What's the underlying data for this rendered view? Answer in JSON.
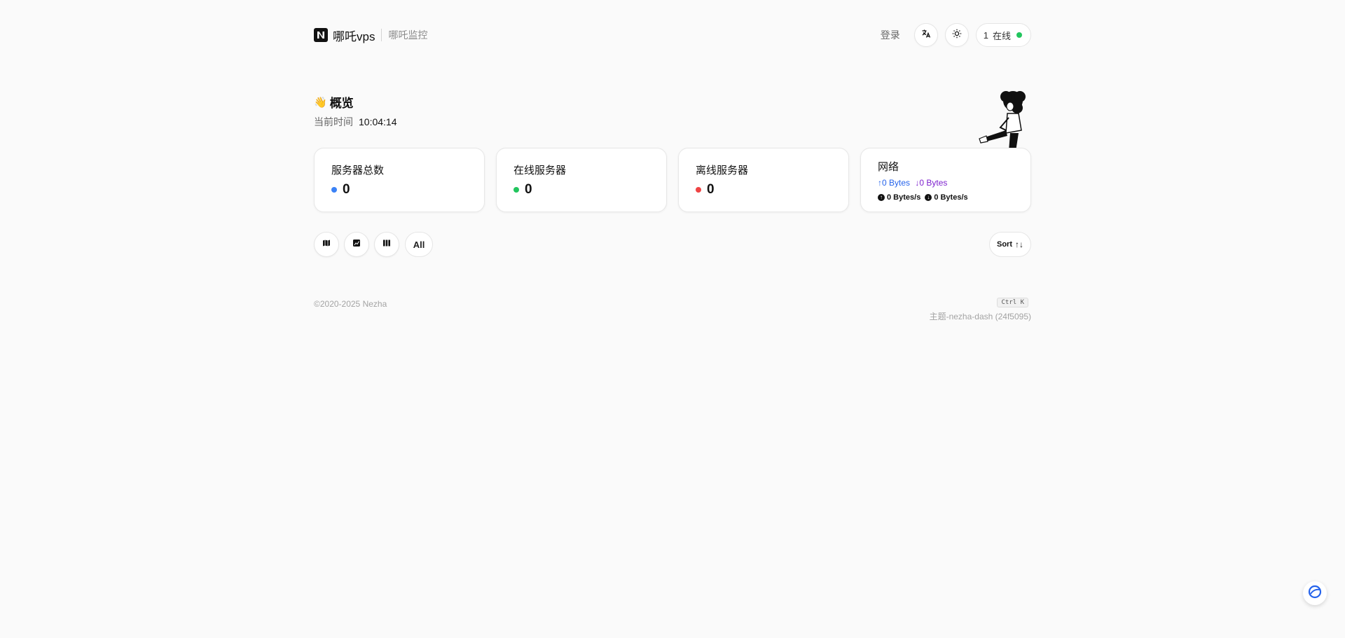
{
  "header": {
    "brand_name": "哪吒vps",
    "brand_sub": "哪吒监控",
    "login_label": "登录",
    "online_count": "1",
    "online_label": "在线"
  },
  "overview": {
    "title": "概览",
    "time_label": "当前时间",
    "time_value": "10:04:14"
  },
  "cards": {
    "total": {
      "title": "服务器总数",
      "value": "0",
      "color": "#3b82f6"
    },
    "online": {
      "title": "在线服务器",
      "value": "0",
      "color": "#22c55e"
    },
    "offline": {
      "title": "离线服务器",
      "value": "0",
      "color": "#ef4444"
    },
    "network": {
      "title": "网络",
      "up_traffic": "↑0 Bytes",
      "down_traffic": "↓0 Bytes",
      "up_speed": "0 Bytes/s",
      "down_speed": "0 Bytes/s"
    }
  },
  "toolbar": {
    "map_icon": "map-icon",
    "chart_icon": "chart-icon",
    "columns_icon": "columns-icon",
    "all_label": "All",
    "sort_label": "Sort"
  },
  "footer": {
    "copyright": "©2020-2025 Nezha",
    "shortcut": "Ctrl K",
    "theme": "主题-nezha-dash (24f5095)"
  }
}
